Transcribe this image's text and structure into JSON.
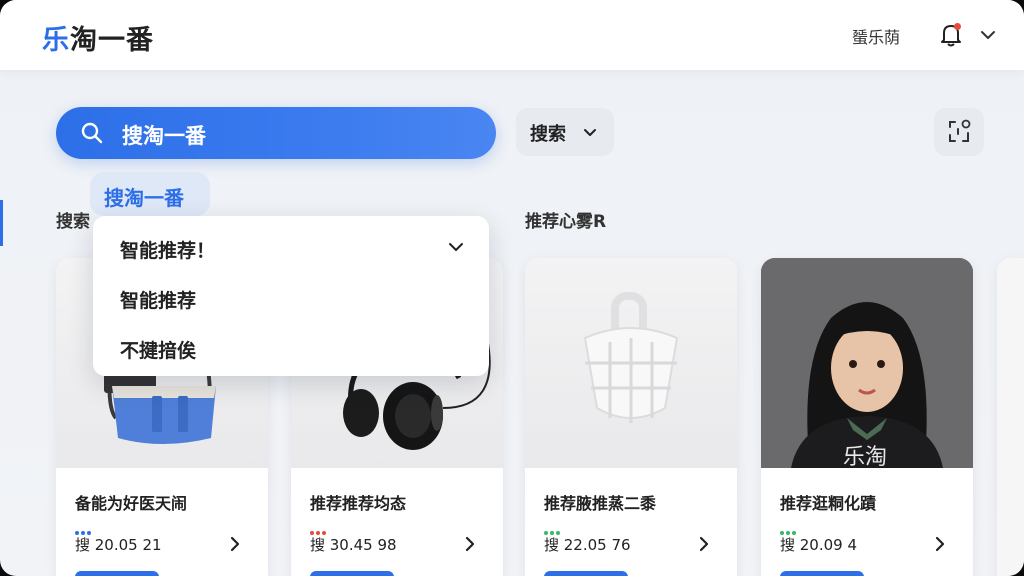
{
  "header": {
    "logo_accent": "乐",
    "logo_rest": "淘一番",
    "user_name": "蜑乐荫"
  },
  "search": {
    "query": "搜淘一番",
    "button_label": "搜索",
    "suggestion_chip": "搜淘一番"
  },
  "sections": {
    "left_title": "搜索",
    "right_title": "推荐心雾R"
  },
  "dropdown": {
    "options": [
      "智能推荐！",
      "智能推荐",
      "不揵揞俟"
    ]
  },
  "products": [
    {
      "name": "备能为好医天闹",
      "price": "搜 20.05 21",
      "dot_color": "#2d6fe8"
    },
    {
      "name": "推荐推荐均态",
      "price": "搜 30.45 98",
      "dot_color": "#e84a3c"
    },
    {
      "name": "推荐腋推蒸二黍",
      "price": "搜 22.05 76",
      "dot_color": "#35b96a"
    },
    {
      "name": "推荐逛粡化蹟",
      "price": "搜 20.09 4",
      "dot_color": "#35b96a"
    }
  ],
  "colors": {
    "accent": "#2d6fe8",
    "notification": "#e84a3c"
  }
}
